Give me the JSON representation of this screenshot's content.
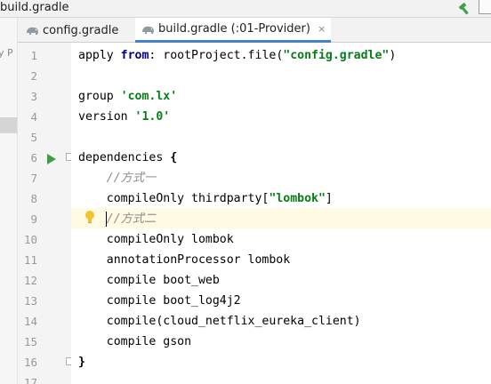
{
  "window": {
    "title": "build.gradle"
  },
  "left_panel": {
    "clipped_text": "y P"
  },
  "tabs": [
    {
      "label": "config.gradle",
      "icon": "gradle-elephant-icon",
      "active": false
    },
    {
      "label": "build.gradle (:01-Provider)",
      "icon": "gradle-elephant-icon",
      "active": true,
      "close": "×"
    }
  ],
  "editor": {
    "line_numbers": [
      "1",
      "2",
      "3",
      "4",
      "5",
      "6",
      "7",
      "8",
      "9",
      "10",
      "11",
      "12",
      "13",
      "14",
      "15",
      "16",
      "17"
    ],
    "current_line": "9",
    "lines": [
      {
        "n": "1",
        "parts": [
          {
            "t": "apply ",
            "c": "p"
          },
          {
            "t": "from",
            "c": "kw"
          },
          {
            "t": ": rootProject.file(",
            "c": "p"
          },
          {
            "t": "\"config.gradle\"",
            "c": "str"
          },
          {
            "t": ")",
            "c": "p"
          }
        ]
      },
      {
        "n": "2",
        "parts": []
      },
      {
        "n": "3",
        "parts": [
          {
            "t": "group ",
            "c": "p"
          },
          {
            "t": "'com.lx'",
            "c": "str"
          }
        ]
      },
      {
        "n": "4",
        "parts": [
          {
            "t": "version ",
            "c": "p"
          },
          {
            "t": "'1.0'",
            "c": "str"
          }
        ]
      },
      {
        "n": "5",
        "parts": []
      },
      {
        "n": "6",
        "parts": [
          {
            "t": "dependencies ",
            "c": "p"
          },
          {
            "t": "{",
            "c": "brace"
          }
        ]
      },
      {
        "n": "7",
        "parts": [
          {
            "t": "    ",
            "c": "p"
          },
          {
            "t": "//方式一",
            "c": "cmt"
          }
        ]
      },
      {
        "n": "8",
        "parts": [
          {
            "t": "    compileOnly thirdparty[",
            "c": "p"
          },
          {
            "t": "\"lombok\"",
            "c": "str"
          },
          {
            "t": "]",
            "c": "p"
          }
        ]
      },
      {
        "n": "9",
        "parts": [
          {
            "t": "    ",
            "c": "p"
          },
          {
            "t": "",
            "c": "caret"
          },
          {
            "t": "//方式二",
            "c": "cmt"
          }
        ]
      },
      {
        "n": "10",
        "parts": [
          {
            "t": "    compileOnly lombok",
            "c": "p"
          }
        ]
      },
      {
        "n": "11",
        "parts": [
          {
            "t": "    annotationProcessor lombok",
            "c": "p"
          }
        ]
      },
      {
        "n": "12",
        "parts": [
          {
            "t": "    compile boot_web",
            "c": "p"
          }
        ]
      },
      {
        "n": "13",
        "parts": [
          {
            "t": "    compile boot_log4j2",
            "c": "p"
          }
        ]
      },
      {
        "n": "14",
        "parts": [
          {
            "t": "    compile(cloud_netflix_eureka_client)",
            "c": "p"
          }
        ]
      },
      {
        "n": "15",
        "parts": [
          {
            "t": "    compile gson",
            "c": "p"
          }
        ]
      },
      {
        "n": "16",
        "parts": [
          {
            "t": "}",
            "c": "brace"
          }
        ]
      },
      {
        "n": "17",
        "parts": []
      }
    ]
  },
  "colors": {
    "keyword": "#000080",
    "string": "#067d17",
    "comment": "#8c8c8c",
    "line_number": "#999999",
    "caret_row": "#fffae3",
    "active_tab_underline": "#4083c9",
    "run_icon": "#3f9e48",
    "bulb_icon": "#f2c230"
  },
  "icons": {
    "build": "hammer-icon",
    "run": "run-gutter-icon",
    "intention": "lightbulb-icon",
    "fold": "fold-marker-icon"
  }
}
